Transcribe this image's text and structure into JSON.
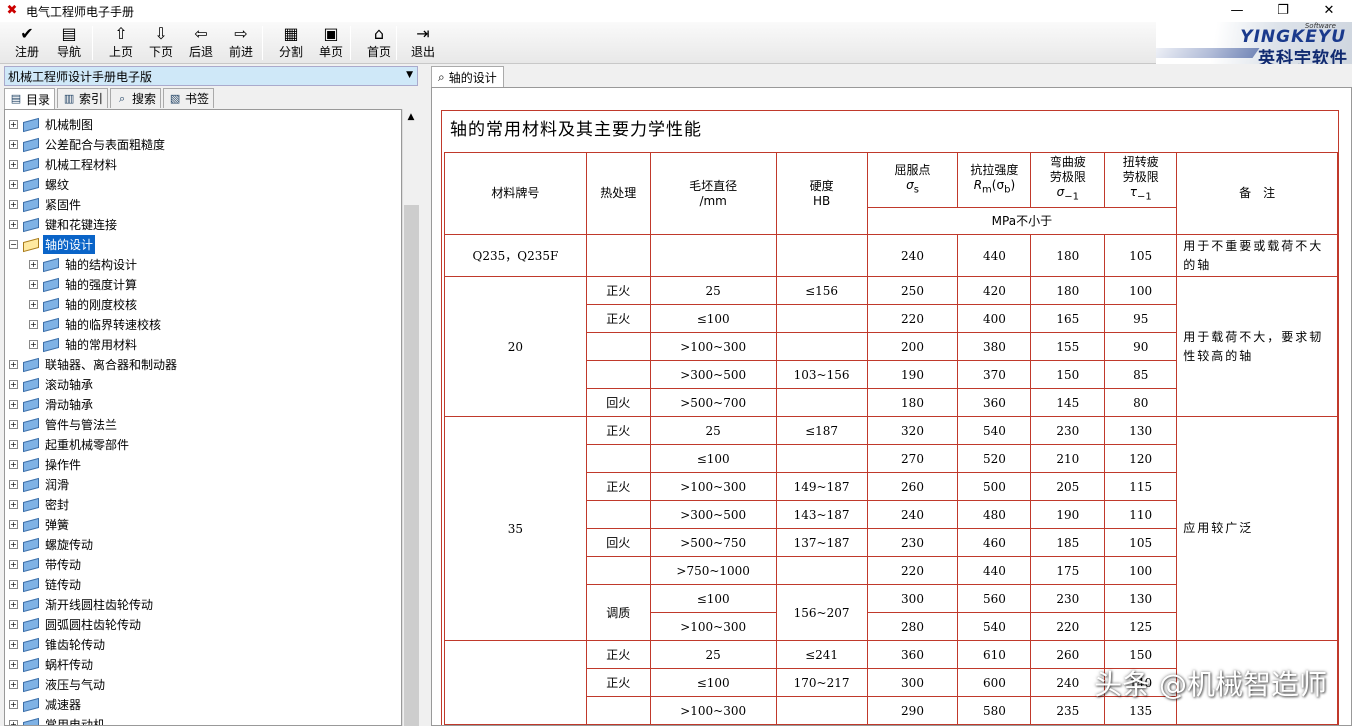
{
  "window": {
    "title": "电气工程师电子手册",
    "minimize": "—",
    "restore": "❐",
    "close": "✕"
  },
  "toolbar": [
    {
      "label": "注册",
      "icon": "✔"
    },
    {
      "label": "导航",
      "icon": "▤"
    },
    {
      "label": "上页",
      "icon": "⇧"
    },
    {
      "label": "下页",
      "icon": "⇩"
    },
    {
      "label": "后退",
      "icon": "⇦"
    },
    {
      "label": "前进",
      "icon": "⇨"
    },
    {
      "label": "分割",
      "icon": "▦"
    },
    {
      "label": "单页",
      "icon": "▣"
    },
    {
      "label": "首页",
      "icon": "⌂"
    },
    {
      "label": "退出",
      "icon": "⇥"
    }
  ],
  "logo": {
    "software": "Software",
    "en": "YINGKEYU",
    "cn": "英科宇软件"
  },
  "combo": {
    "value": "机械工程师设计手册电子版"
  },
  "left_tabs": [
    {
      "label": "目录",
      "icon": "▤"
    },
    {
      "label": "索引",
      "icon": "▥"
    },
    {
      "label": "搜索",
      "icon": "⌕"
    },
    {
      "label": "书签",
      "icon": "▧"
    }
  ],
  "tree": [
    {
      "label": "机械制图",
      "level": 0,
      "expander": "+"
    },
    {
      "label": "公差配合与表面粗糙度",
      "level": 0,
      "expander": "+"
    },
    {
      "label": "机械工程材料",
      "level": 0,
      "expander": "+"
    },
    {
      "label": "螺纹",
      "level": 0,
      "expander": "+"
    },
    {
      "label": "紧固件",
      "level": 0,
      "expander": "+"
    },
    {
      "label": "键和花键连接",
      "level": 0,
      "expander": "+"
    },
    {
      "label": "轴的设计",
      "level": 0,
      "expander": "−",
      "selected": true,
      "open": true
    },
    {
      "label": "轴的结构设计",
      "level": 1,
      "expander": "+"
    },
    {
      "label": "轴的强度计算",
      "level": 1,
      "expander": "+"
    },
    {
      "label": "轴的刚度校核",
      "level": 1,
      "expander": "+"
    },
    {
      "label": "轴的临界转速校核",
      "level": 1,
      "expander": "+"
    },
    {
      "label": "轴的常用材料",
      "level": 1,
      "expander": "+"
    },
    {
      "label": "联轴器、离合器和制动器",
      "level": 0,
      "expander": "+"
    },
    {
      "label": "滚动轴承",
      "level": 0,
      "expander": "+"
    },
    {
      "label": "滑动轴承",
      "level": 0,
      "expander": "+"
    },
    {
      "label": "管件与管法兰",
      "level": 0,
      "expander": "+"
    },
    {
      "label": "起重机械零部件",
      "level": 0,
      "expander": "+"
    },
    {
      "label": "操作件",
      "level": 0,
      "expander": "+"
    },
    {
      "label": "润滑",
      "level": 0,
      "expander": "+"
    },
    {
      "label": "密封",
      "level": 0,
      "expander": "+"
    },
    {
      "label": "弹簧",
      "level": 0,
      "expander": "+"
    },
    {
      "label": "螺旋传动",
      "level": 0,
      "expander": "+"
    },
    {
      "label": "带传动",
      "level": 0,
      "expander": "+"
    },
    {
      "label": "链传动",
      "level": 0,
      "expander": "+"
    },
    {
      "label": "渐开线圆柱齿轮传动",
      "level": 0,
      "expander": "+"
    },
    {
      "label": "圆弧圆柱齿轮传动",
      "level": 0,
      "expander": "+"
    },
    {
      "label": "锥齿轮传动",
      "level": 0,
      "expander": "+"
    },
    {
      "label": "蜗杆传动",
      "level": 0,
      "expander": "+"
    },
    {
      "label": "液压与气动",
      "level": 0,
      "expander": "+"
    },
    {
      "label": "减速器",
      "level": 0,
      "expander": "+"
    },
    {
      "label": "常用电动机",
      "level": 0,
      "expander": "+"
    }
  ],
  "right_tab": {
    "label": "轴的设计",
    "icon": "⌕"
  },
  "doc": {
    "title": "轴的常用材料及其主要力学性能",
    "headers": {
      "material": "材料牌号",
      "treatment": "热处理",
      "diameter": [
        "毛坯直径",
        "/mm"
      ],
      "hardness": [
        "硬度",
        "HB"
      ],
      "yield": [
        "屈服点",
        "σ",
        "s"
      ],
      "tensile": [
        "抗拉强度",
        "R",
        "m",
        "(σ",
        "b",
        ")"
      ],
      "bending": [
        "弯曲疲",
        "劳极限",
        "σ",
        "−1"
      ],
      "torsion": [
        "扭转疲",
        "劳极限",
        "τ",
        "−1"
      ],
      "note": "备　注",
      "unit": "MPa不小于"
    },
    "rows": [
      {
        "material": "Q235，Q235F",
        "treatment": "",
        "diameter": "",
        "hardness": "",
        "ys": "240",
        "ts": "440",
        "bf": "180",
        "tf": "105",
        "note": "用于不重要或载荷不大的轴"
      },
      {
        "material": "20",
        "treatment": "正火",
        "diameter": "25",
        "hardness": "≤156",
        "ys": "250",
        "ts": "420",
        "bf": "180",
        "tf": "100",
        "note": "用于载荷不大，要求韧性较高的轴"
      },
      {
        "treatment": "正火",
        "diameter": "≤100",
        "hardness": "",
        "ys": "220",
        "ts": "400",
        "bf": "165",
        "tf": "95"
      },
      {
        "treatment": "",
        "diameter": ">100~300",
        "hardness": "",
        "ys": "200",
        "ts": "380",
        "bf": "155",
        "tf": "90"
      },
      {
        "treatment": "",
        "diameter": ">300~500",
        "hardness": "103~156",
        "ys": "190",
        "ts": "370",
        "bf": "150",
        "tf": "85"
      },
      {
        "treatment": "回火",
        "diameter": ">500~700",
        "hardness": "",
        "ys": "180",
        "ts": "360",
        "bf": "145",
        "tf": "80"
      },
      {
        "material": "35",
        "treatment": "正火",
        "diameter": "25",
        "hardness": "≤187",
        "ys": "320",
        "ts": "540",
        "bf": "230",
        "tf": "130",
        "note": "应用较广泛"
      },
      {
        "treatment": "",
        "diameter": "≤100",
        "hardness": "",
        "ys": "270",
        "ts": "520",
        "bf": "210",
        "tf": "120"
      },
      {
        "treatment": "正火",
        "diameter": ">100~300",
        "hardness": "149~187",
        "ys": "260",
        "ts": "500",
        "bf": "205",
        "tf": "115"
      },
      {
        "treatment": "",
        "diameter": ">300~500",
        "hardness": "143~187",
        "ys": "240",
        "ts": "480",
        "bf": "190",
        "tf": "110"
      },
      {
        "treatment": "回火",
        "diameter": ">500~750",
        "hardness": "137~187",
        "ys": "230",
        "ts": "460",
        "bf": "185",
        "tf": "105"
      },
      {
        "treatment": "",
        "diameter": ">750~1000",
        "hardness": "",
        "ys": "220",
        "ts": "440",
        "bf": "175",
        "tf": "100"
      },
      {
        "treatment": "调质",
        "diameter": "≤100",
        "hardness": "156~207",
        "ys": "300",
        "ts": "560",
        "bf": "230",
        "tf": "130"
      },
      {
        "treatment": "",
        "diameter": ">100~300",
        "hardness": "",
        "ys": "280",
        "ts": "540",
        "bf": "220",
        "tf": "125"
      },
      {
        "material": "",
        "treatment": "正火",
        "diameter": "25",
        "hardness": "≤241",
        "ys": "360",
        "ts": "610",
        "bf": "260",
        "tf": "150",
        "note": ""
      },
      {
        "treatment": "正火",
        "diameter": "≤100",
        "hardness": "170~217",
        "ys": "300",
        "ts": "600",
        "bf": "240",
        "tf": "140"
      },
      {
        "treatment": "",
        "diameter": ">100~300",
        "hardness": "",
        "ys": "290",
        "ts": "580",
        "bf": "235",
        "tf": "135"
      }
    ]
  },
  "watermark": "头条 @机械智造师"
}
